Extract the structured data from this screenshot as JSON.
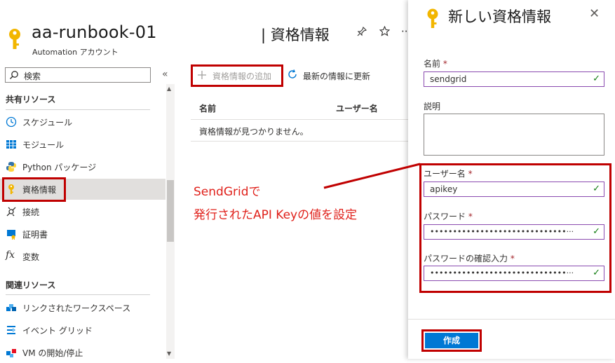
{
  "header": {
    "resource_name": "aa-runbook-01",
    "resource_type": "Automation アカウント",
    "page_title": "| 資格情報",
    "pin_icon": "pin-icon",
    "star_icon": "star-icon",
    "more_label": "···"
  },
  "sidebar": {
    "search_placeholder": "検索",
    "collapse_label": "«",
    "sections": [
      {
        "title": "共有リソース",
        "items": [
          {
            "label": "スケジュール",
            "icon": "clock-icon"
          },
          {
            "label": "モジュール",
            "icon": "module-icon"
          },
          {
            "label": "Python パッケージ",
            "icon": "python-icon"
          },
          {
            "label": "資格情報",
            "icon": "key-icon",
            "selected": true
          },
          {
            "label": "接続",
            "icon": "connection-icon"
          },
          {
            "label": "証明書",
            "icon": "certificate-icon"
          },
          {
            "label": "変数",
            "icon": "variable-icon"
          }
        ]
      },
      {
        "title": "関連リソース",
        "items": [
          {
            "label": "リンクされたワークスペース",
            "icon": "workspace-icon"
          },
          {
            "label": "イベント グリッド",
            "icon": "event-grid-icon"
          },
          {
            "label": "VM の開始/停止",
            "icon": "vm-icon"
          }
        ]
      }
    ]
  },
  "toolbar": {
    "add_label": "資格情報の追加",
    "refresh_label": "最新の情報に更新"
  },
  "table": {
    "columns": [
      "名前",
      "ユーザー名"
    ],
    "empty_message": "資格情報が見つかりません。"
  },
  "annotation": {
    "line1": "SendGridで",
    "line2": "発行されたAPI Keyの値を設定"
  },
  "panel": {
    "title": "新しい資格情報",
    "close_label": "✕",
    "name_label": "名前",
    "name_value": "sendgrid",
    "description_label": "説明",
    "description_value": "",
    "username_label": "ユーザー名",
    "username_value": "apikey",
    "password_label": "パスワード",
    "password_value": "••••••••••••••••••••••••••••••···",
    "confirm_label": "パスワードの確認入力",
    "confirm_value": "••••••••••••••••••••••••••••••···",
    "required_mark": "*",
    "create_label": "作成"
  },
  "colors": {
    "accent": "#0078d4",
    "highlight_box": "#c00000",
    "annotation": "#e0211b",
    "valid_check": "#107c10",
    "field_border": "#8a4bb0"
  }
}
